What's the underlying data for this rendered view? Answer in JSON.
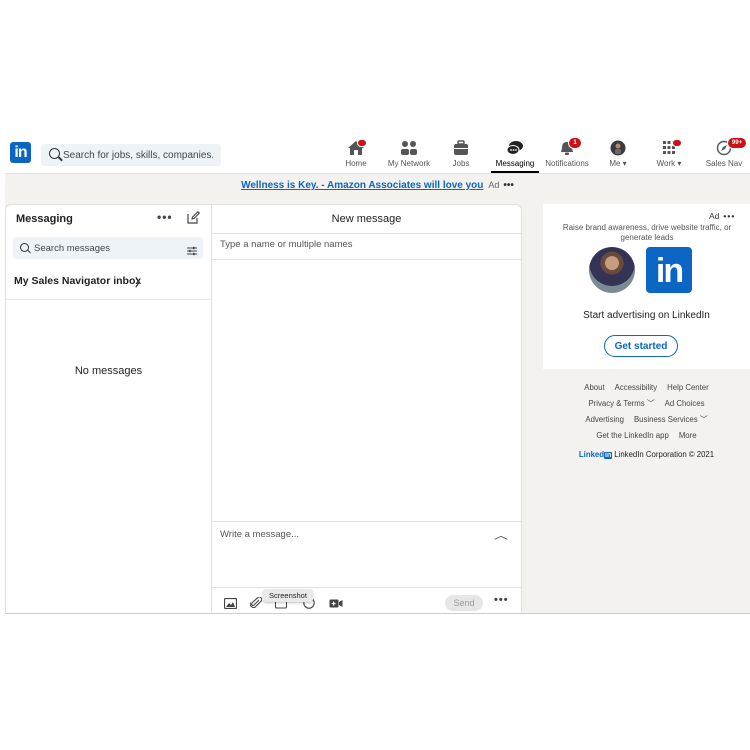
{
  "nav": {
    "logo": "in",
    "search_placeholder": "Search for jobs, skills, companies...",
    "items": [
      {
        "label": "Home",
        "badge": ""
      },
      {
        "label": "My Network",
        "badge": ""
      },
      {
        "label": "Jobs",
        "badge": ""
      },
      {
        "label": "Messaging",
        "badge": ""
      },
      {
        "label": "Notifications",
        "badge": "1"
      },
      {
        "label": "Me",
        "badge": ""
      },
      {
        "label": "Work",
        "badge": ""
      },
      {
        "label": "Sales Nav",
        "badge": "99+"
      }
    ]
  },
  "banner": {
    "link": "Wellness is Key. - Amazon Associates will love you",
    "ad_label": "Ad",
    "more": "•••"
  },
  "messaging": {
    "title": "Messaging",
    "more": "•••",
    "search_placeholder": "Search messages",
    "inbox_label": "My Sales Navigator inbox",
    "inbox_chevron": "〉",
    "empty": "No messages"
  },
  "new_message": {
    "title": "New message",
    "to_placeholder": "Type a name or multiple names",
    "body_placeholder": "Write a message...",
    "tooltip": "Screenshot",
    "send_label": "Send",
    "more": "•••"
  },
  "ad_card": {
    "ad_label": "Ad",
    "more": "•••",
    "description": "Raise brand awareness, drive website traffic, or generate leads",
    "logo": "in",
    "cta_text": "Start advertising on LinkedIn",
    "button": "Get started"
  },
  "footer": {
    "row1": [
      "About",
      "Accessibility",
      "Help Center"
    ],
    "row2": [
      "Privacy & Terms ﹀",
      "Ad Choices"
    ],
    "row3": [
      "Advertising",
      "Business Services ﹀"
    ],
    "row4": [
      "Get the LinkedIn app",
      "More"
    ],
    "brand": "Linked",
    "brand_in": "in",
    "copyright": "LinkedIn Corporation © 2021"
  }
}
